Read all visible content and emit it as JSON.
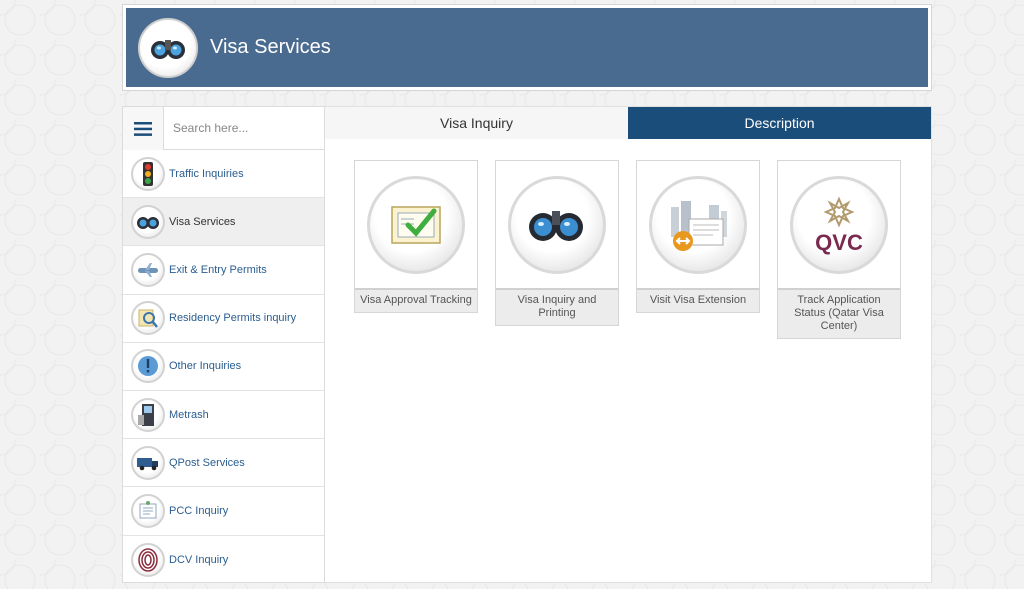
{
  "header": {
    "title": "Visa Services",
    "logo_icon": "binoculars-icon",
    "background": "#4a6b90"
  },
  "search": {
    "placeholder": "Search here...",
    "value": ""
  },
  "sidebar": {
    "menu_icon": "hamburger-menu-icon",
    "items": [
      {
        "label": "Traffic Inquiries",
        "icon": "traffic-light-icon"
      },
      {
        "label": "Visa Services",
        "icon": "binoculars-icon",
        "active": true
      },
      {
        "label": "Exit & Entry Permits",
        "icon": "airplane-icon"
      },
      {
        "label": "Residency Permits inquiry",
        "icon": "magnifier-icon"
      },
      {
        "label": "Other Inquiries",
        "icon": "exclamation-icon"
      },
      {
        "label": "Metrash",
        "icon": "kiosk-icon"
      },
      {
        "label": "QPost Services",
        "icon": "delivery-truck-icon"
      },
      {
        "label": "PCC Inquiry",
        "icon": "certificate-icon"
      },
      {
        "label": "DCV Inquiry",
        "icon": "fingerprint-icon"
      }
    ]
  },
  "tabs": [
    {
      "label": "Visa Inquiry",
      "selected": true
    },
    {
      "label": "Description",
      "selected": false
    }
  ],
  "cards": [
    {
      "label": "Visa Approval Tracking",
      "icon": "approved-document-icon"
    },
    {
      "label": "Visa Inquiry and Printing",
      "icon": "binoculars-icon"
    },
    {
      "label": "Visit Visa Extension",
      "icon": "visa-extension-icon"
    },
    {
      "label": "Track Application Status (Qatar Visa Center)",
      "icon": "qvc-logo-icon",
      "logo_text": "QVC"
    }
  ],
  "colors": {
    "accent_tab": "#1b4d7a",
    "link": "#2a5d8f",
    "qvc": "#7a2a4e"
  }
}
